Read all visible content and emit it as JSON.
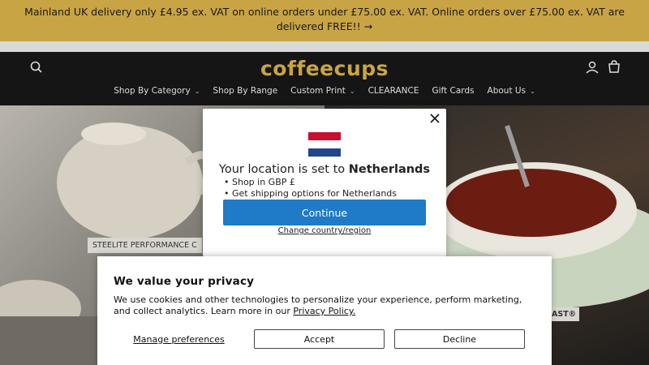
{
  "announcement": {
    "text": "Mainland UK delivery only £4.95 ex. VAT on online orders under £75.00 ex. VAT. Online orders over £75.00 ex. VAT are delivered FREE!! →"
  },
  "header": {
    "logo": "coffeecups",
    "icons": {
      "search": "search-icon",
      "account": "account-icon",
      "cart": "cart-icon"
    },
    "nav": [
      {
        "label": "Shop By Category",
        "dropdown": true
      },
      {
        "label": "Shop By Range",
        "dropdown": false
      },
      {
        "label": "Custom Print",
        "dropdown": true
      },
      {
        "label": "CLEARANCE",
        "dropdown": false
      },
      {
        "label": "Gift Cards",
        "dropdown": false
      },
      {
        "label": "About Us",
        "dropdown": true
      }
    ]
  },
  "hero": {
    "left_badge": "STEELITE PERFORMANCE C",
    "right_badge": "AST®"
  },
  "location_modal": {
    "title_prefix": "Your location is set to",
    "country": "Netherlands",
    "bullets": [
      "• Shop in GBP £",
      "• Get shipping options for Netherlands"
    ],
    "continue_label": "Continue",
    "change_link": "Change country/region",
    "flag_colors": [
      "#c8102e",
      "#ffffff",
      "#21468b"
    ]
  },
  "privacy": {
    "title": "We value your privacy",
    "text": "We use cookies and other technologies to personalize your experience, perform marketing, and collect analytics. Learn more in our",
    "link": "Privacy Policy.",
    "manage_label": "Manage preferences",
    "accept_label": "Accept",
    "decline_label": "Decline"
  },
  "colors": {
    "accent_gold": "#c8a444",
    "header_bg": "#151515",
    "button_blue": "#1f7ac7"
  }
}
